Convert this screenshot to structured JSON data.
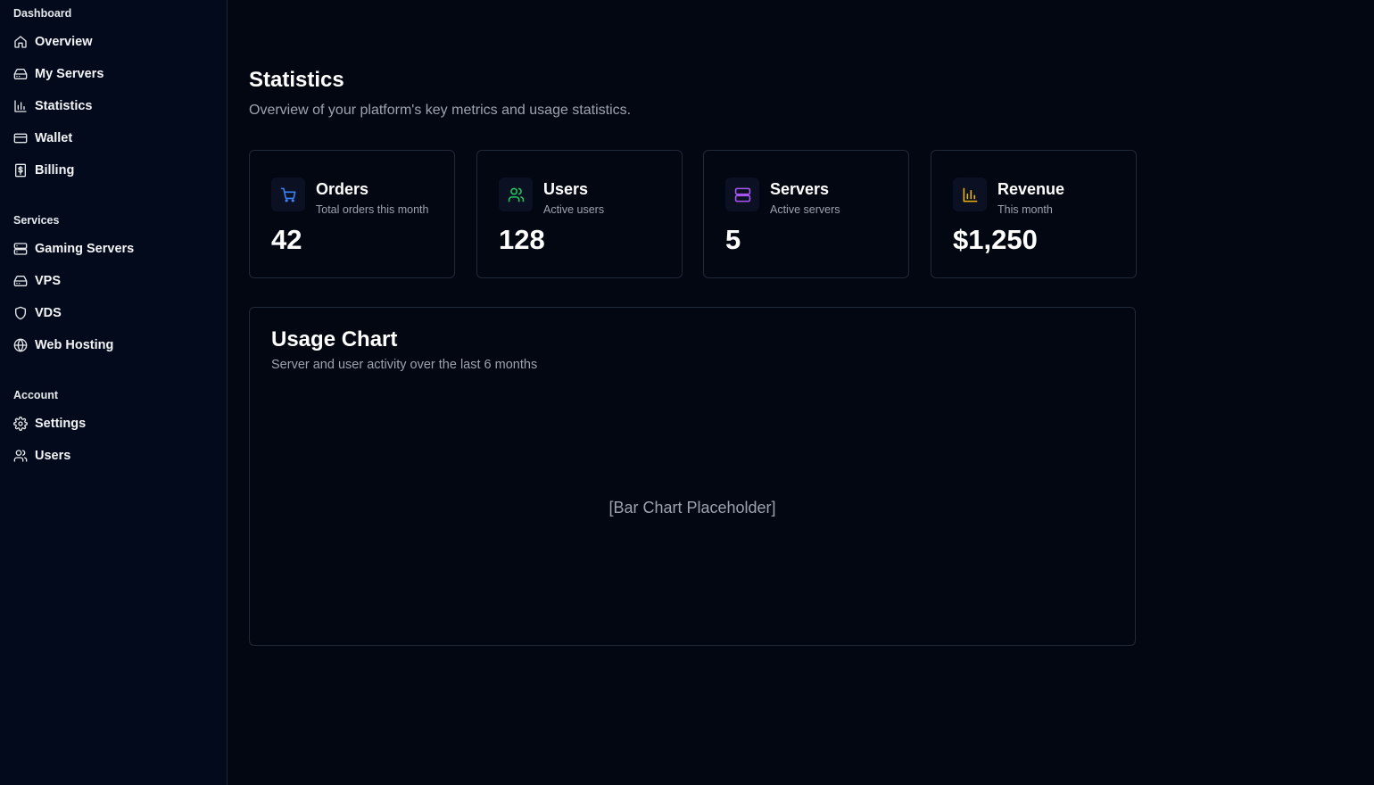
{
  "sidebar": {
    "sections": [
      {
        "title": "Dashboard",
        "items": [
          {
            "label": "Overview",
            "icon": "home-icon"
          },
          {
            "label": "My Servers",
            "icon": "hard-drive-icon"
          },
          {
            "label": "Statistics",
            "icon": "bar-chart-icon"
          },
          {
            "label": "Wallet",
            "icon": "credit-card-icon"
          },
          {
            "label": "Billing",
            "icon": "receipt-dollar-icon"
          }
        ]
      },
      {
        "title": "Services",
        "items": [
          {
            "label": "Gaming Servers",
            "icon": "server-icon"
          },
          {
            "label": "VPS",
            "icon": "hard-drive-icon"
          },
          {
            "label": "VDS",
            "icon": "shield-icon"
          },
          {
            "label": "Web Hosting",
            "icon": "globe-icon"
          }
        ]
      },
      {
        "title": "Account",
        "items": [
          {
            "label": "Settings",
            "icon": "gear-icon"
          },
          {
            "label": "Users",
            "icon": "users-icon"
          }
        ]
      }
    ]
  },
  "page": {
    "title": "Statistics",
    "subtitle": "Overview of your platform's key metrics and usage statistics."
  },
  "cards": [
    {
      "title": "Orders",
      "subtitle": "Total orders this month",
      "value": "42",
      "icon": "shopping-cart-icon",
      "color": "#3b82f6"
    },
    {
      "title": "Users",
      "subtitle": "Active users",
      "value": "128",
      "icon": "users-icon",
      "color": "#22c55e"
    },
    {
      "title": "Servers",
      "subtitle": "Active servers",
      "value": "5",
      "icon": "server-icon",
      "color": "#a855f7"
    },
    {
      "title": "Revenue",
      "subtitle": "This month",
      "value": "$1,250",
      "icon": "bar-chart-icon",
      "color": "#eab308"
    }
  ],
  "chart": {
    "title": "Usage Chart",
    "subtitle": "Server and user activity over the last 6 months",
    "placeholder": "[Bar Chart Placeholder]"
  },
  "colors": {
    "background": "#030712",
    "sidebar": "#030a1c",
    "border": "#1f2937",
    "muted_text": "#9ca3af"
  }
}
